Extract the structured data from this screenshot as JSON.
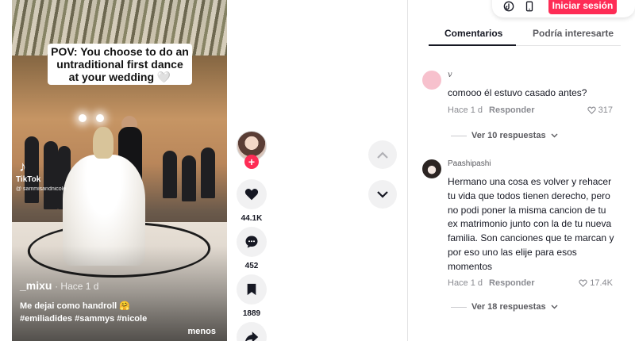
{
  "video": {
    "caption_overlay": "POV: You choose to do an untraditional first dance at your wedding 🤍",
    "watermark_brand": "TikTok",
    "watermark_handle": "@ sammisandnicole",
    "author": "_mixu",
    "time": "· Hace 1 d",
    "description": "Me dejai como handroll 🤗 #emiliadides #sammys #nicole",
    "less_label": "menos"
  },
  "actions": {
    "like_count": "44.1K",
    "comment_count": "452",
    "save_count": "1889"
  },
  "topbar": {
    "login_label": "Iniciar sesión"
  },
  "tabs": {
    "comments_label": "Comentarios",
    "related_label": "Podría interesarte"
  },
  "comments": [
    {
      "user": "v",
      "text": "comooo él estuvo casado antes?",
      "time": "Hace 1 d",
      "reply_label": "Responder",
      "likes": "317",
      "view_replies": "Ver 10 respuestas"
    },
    {
      "user": "Paashipashi",
      "text": "Hermano una cosa es volver y rehacer tu vida que todos tienen derecho, pero no podi poner la misma cancion de tu ex matrimonio junto con la de tu nueva familia. Son canciones que te marcan y por eso uno las elije para esos momentos",
      "time": "Hace 1 d",
      "reply_label": "Responder",
      "likes": "17.4K",
      "view_replies": "Ver 18 respuestas"
    }
  ],
  "colors": {
    "accent": "#fe2c55",
    "avatar_pink": "#f7c1cd"
  },
  "icons": [
    "heart-icon",
    "comment-icon",
    "bookmark-icon",
    "share-icon",
    "chevron-up-icon",
    "chevron-down-icon",
    "tiktok-icon",
    "phone-icon",
    "plus-icon"
  ]
}
